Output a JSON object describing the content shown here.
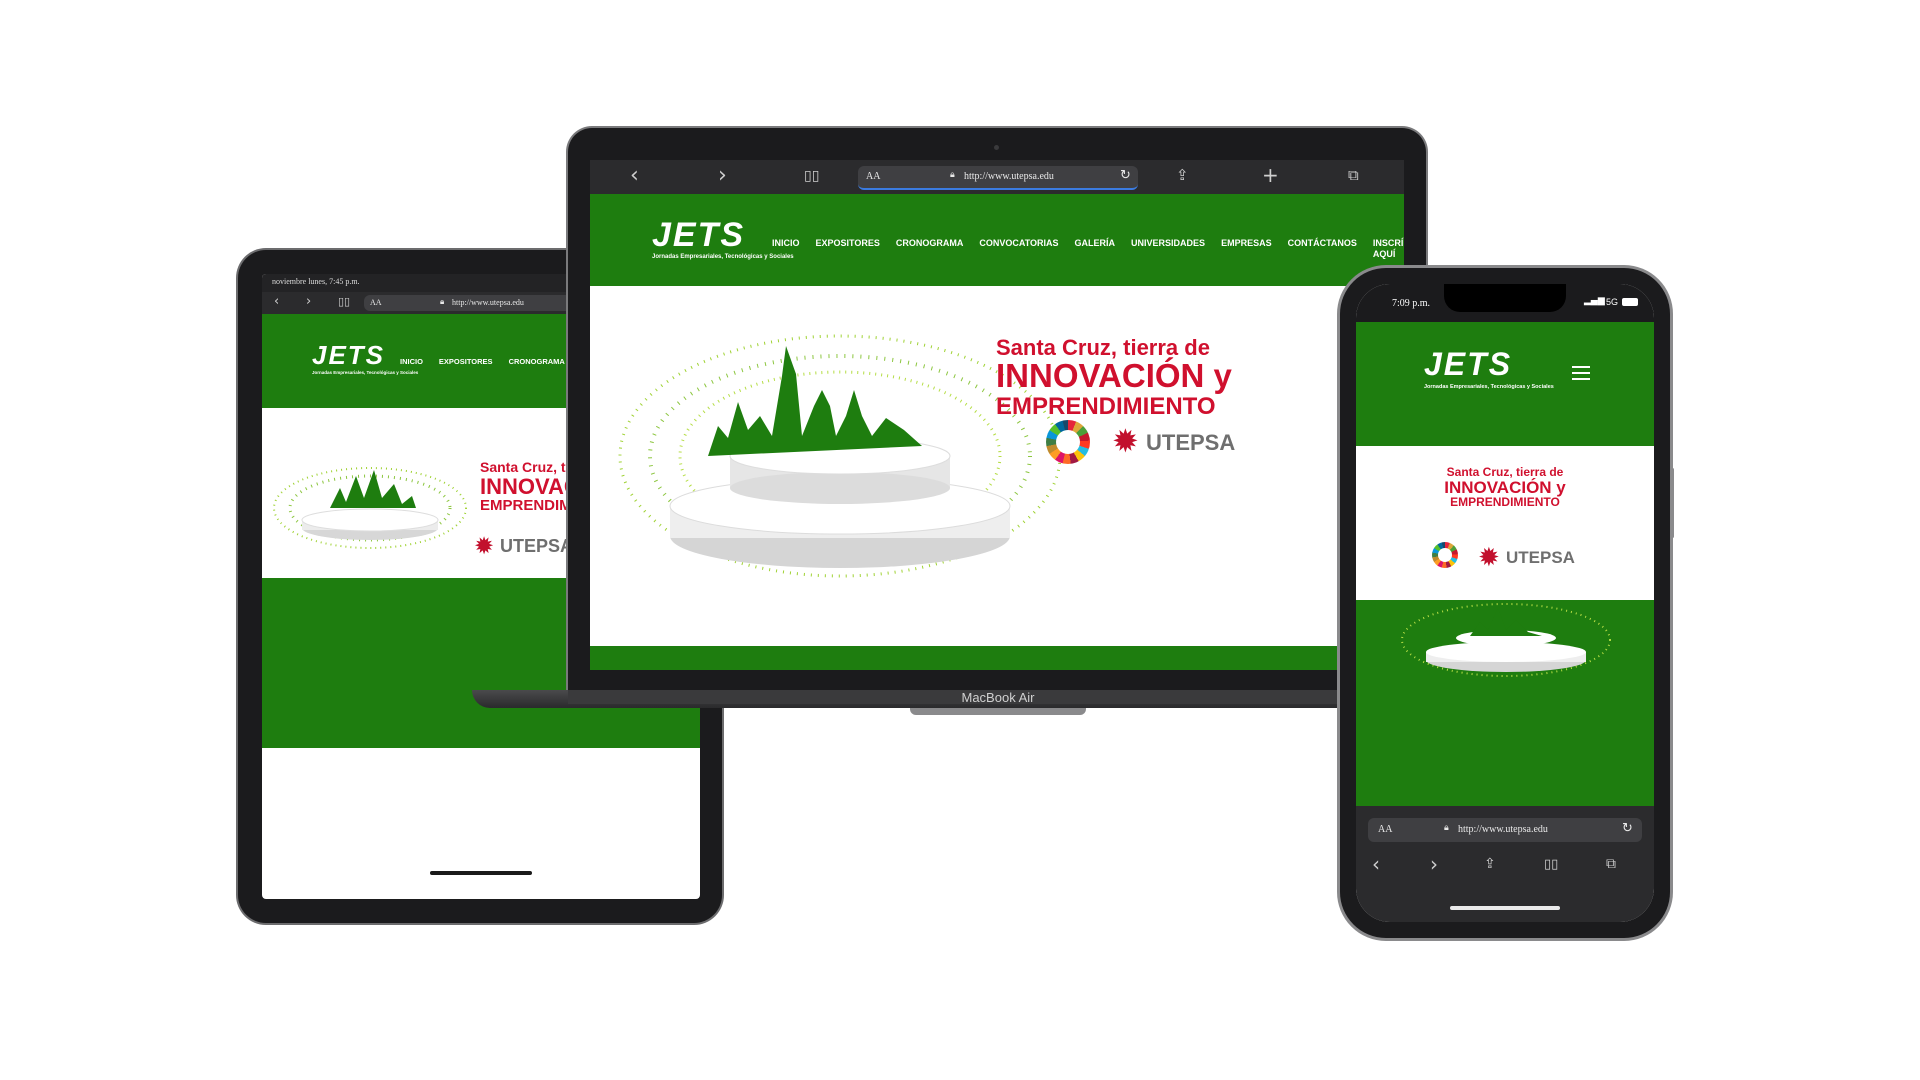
{
  "site": {
    "logo": "JETS",
    "logo_sub": "Jornadas Empresariales, Tecnológicas y Sociales",
    "nav": [
      "INICIO",
      "EXPOSITORES",
      "CRONOGRAMA",
      "CONVOCATORIAS",
      "GALERÍA",
      "UNIVERSIDADES",
      "EMPRESAS",
      "CONTÁCTANOS",
      "INSCRÍBETE AQUÍ"
    ],
    "headline_line1": "Santa Cruz, tierra de",
    "headline_line2": "INNOVACIÓN y",
    "headline_line3": "EMPRENDIMIENTO",
    "utepsa": "UTEPSA",
    "sdg_label": "SDG"
  },
  "browser": {
    "text_size": "AA",
    "url": "http://www.utepsa.edu"
  },
  "laptop": {
    "model_label": "MacBook Air"
  },
  "tablet": {
    "status": "noviembre lunes, 7:45 p.m."
  },
  "phone": {
    "time": "7:09 p.m.",
    "signal": "5G"
  },
  "colors": {
    "brand_green": "#1e7d0f",
    "headline_red": "#d0102e",
    "device_frame": "#1b1b1d"
  }
}
